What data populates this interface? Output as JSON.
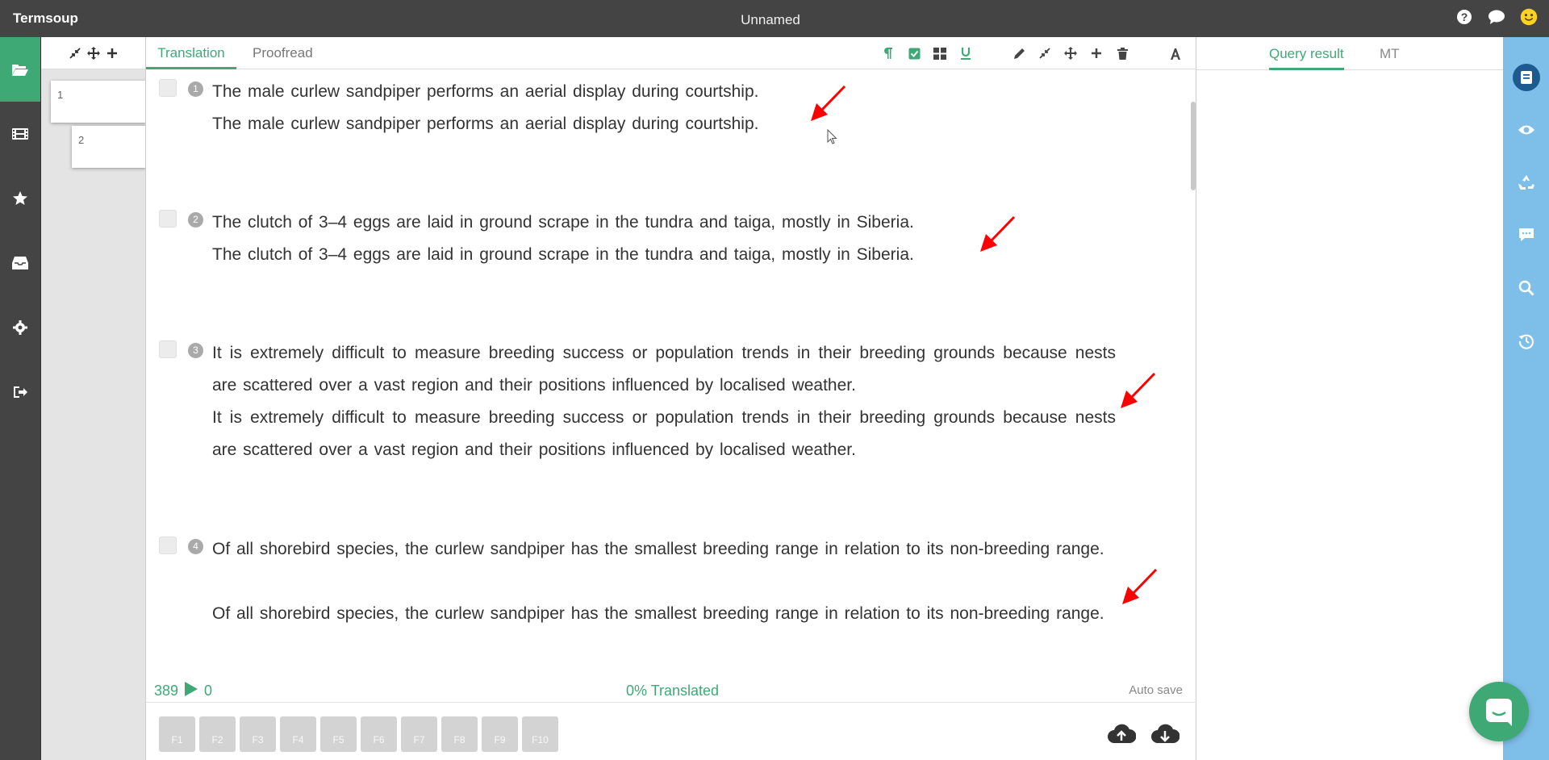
{
  "app": {
    "name": "Termsoup",
    "document_title": "Unnamed"
  },
  "topbar": {
    "icons": [
      "help-icon",
      "chat-icon",
      "smiley-avatar-icon"
    ]
  },
  "left_nav": {
    "items": [
      "folder-open-icon",
      "film-icon",
      "star-icon",
      "inbox-icon",
      "gear-icon",
      "sign-out-icon"
    ],
    "active": "folder-open-icon"
  },
  "thumbnails": {
    "tools": [
      "compress-icon",
      "move-icon",
      "plus-icon"
    ],
    "pages": [
      "1",
      "2"
    ]
  },
  "editor": {
    "tabs": [
      "Translation",
      "Proofread"
    ],
    "active_tab": "Translation",
    "format_icons": [
      "pilcrow-icon",
      "check-square-icon",
      "grid-icon",
      "underline-icon",
      "pencil-icon",
      "compress-icon",
      "move-icon",
      "plus-icon",
      "trash-icon",
      "font-icon"
    ],
    "segments": [
      {
        "number": "1",
        "source": "The male curlew sandpiper performs an aerial display during courtship.",
        "target": "The male curlew sandpiper performs an aerial display during courtship."
      },
      {
        "number": "2",
        "source": "The clutch of 3–4 eggs are laid in ground scrape in the tundra and taiga, mostly in Siberia.",
        "target": "The clutch of 3–4 eggs are laid in ground scrape in the tundra and taiga, mostly in Siberia."
      },
      {
        "number": "3",
        "source": "It is extremely difficult to measure breeding success or population trends in their breeding grounds because nests are scattered over a vast region and their positions influenced by localised weather.",
        "target": "It is extremely difficult to measure breeding success or population trends in their breeding grounds because nests are scattered over a vast region and their positions influenced by localised weather."
      },
      {
        "number": "4",
        "source": "Of all shorebird species, the curlew sandpiper has the smallest breeding range in relation to its non-breeding range.",
        "target": "Of all shorebird species, the curlew sandpiper has the smallest breeding range in relation to its non-breeding range."
      }
    ],
    "status": {
      "word_count": "389",
      "done_count": "0",
      "progress": "0% Translated",
      "autosave": "Auto save"
    },
    "function_keys": [
      "F1",
      "F2",
      "F3",
      "F4",
      "F5",
      "F6",
      "F7",
      "F8",
      "F9",
      "F10"
    ],
    "cloud_icons": [
      "cloud-upload-icon",
      "cloud-download-icon"
    ]
  },
  "right_panel": {
    "tabs": [
      "Query result",
      "MT"
    ],
    "active_tab": "Query result"
  },
  "right_rail": {
    "icons": [
      "book-icon",
      "eye-icon",
      "recycle-icon",
      "comment-icon",
      "search-icon",
      "history-icon"
    ],
    "active": "book-icon"
  },
  "colors": {
    "accent": "#3fa976",
    "dark": "#444444",
    "rail": "#7ebfea",
    "annotation": "#ff0000"
  }
}
